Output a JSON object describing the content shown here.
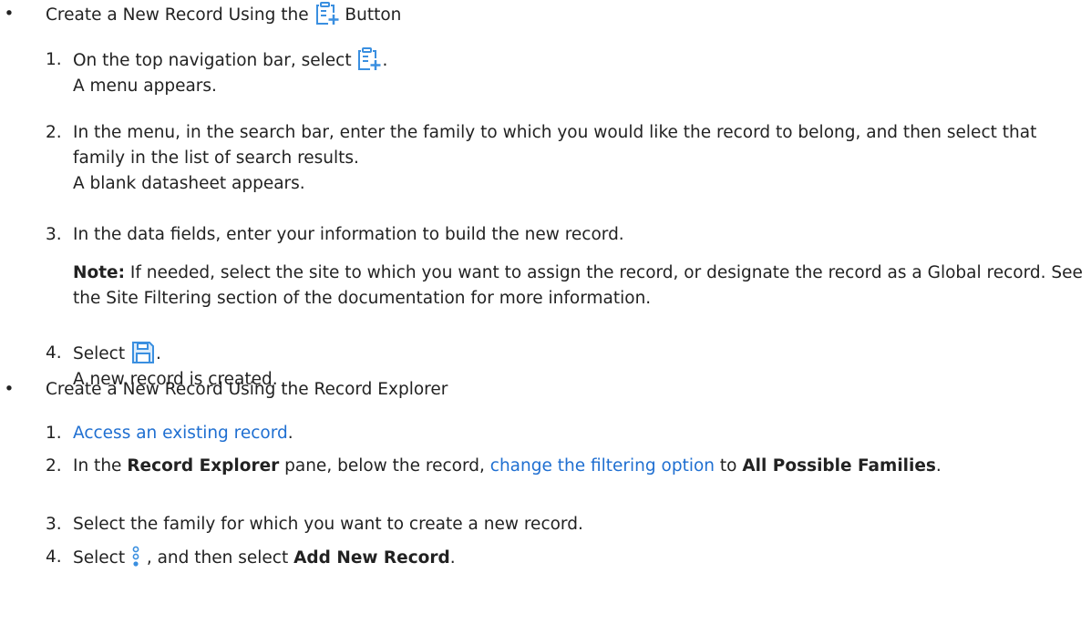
{
  "section1": {
    "heading_before": "Create a New Record Using the",
    "heading_after": "Button",
    "steps": [
      {
        "num": "1.",
        "text_before": "On the top navigation bar, select",
        "text_after": ".",
        "result": "A menu appears."
      },
      {
        "num": "2.",
        "text": "In the menu, in the search bar, enter the family to which you would like the record to belong, and then select that family in the list of search results.",
        "result": "A blank datasheet appears."
      },
      {
        "num": "3.",
        "text": "In the data fields, enter your information to build the new record.",
        "note_label": "Note:",
        "note_text": " If needed, select the site to which you want to assign the record, or designate the record as a Global record. See the Site Filtering section of the documentation for more information."
      },
      {
        "num": "4.",
        "text_before": "Select",
        "text_after": ".",
        "result": "A new record is created."
      }
    ]
  },
  "section2": {
    "heading": "Create a New Record Using the Record Explorer",
    "steps": [
      {
        "num": "1.",
        "link": "Access an existing record",
        "text_after": "."
      },
      {
        "num": "2.",
        "text_before": "In the ",
        "bold1": "Record Explorer",
        "text_mid1": " pane, below the record, ",
        "link": "change the filtering option",
        "text_mid2": " to ",
        "bold2": "All Possible Families",
        "text_after": "."
      },
      {
        "num": "3.",
        "text": "Select the family for which you want to create a new record."
      },
      {
        "num": "4.",
        "text_before": "Select ",
        "text_mid": " , and then select ",
        "bold": "Add New Record",
        "text_after": "."
      }
    ]
  },
  "bullet": "•",
  "icons": {
    "new_record": "new-record-icon",
    "save": "save-icon",
    "more_options": "vertical-ellipsis-icon"
  },
  "colors": {
    "text": "#222222",
    "link": "#1f6fd1",
    "icon": "#3a8fe0"
  }
}
